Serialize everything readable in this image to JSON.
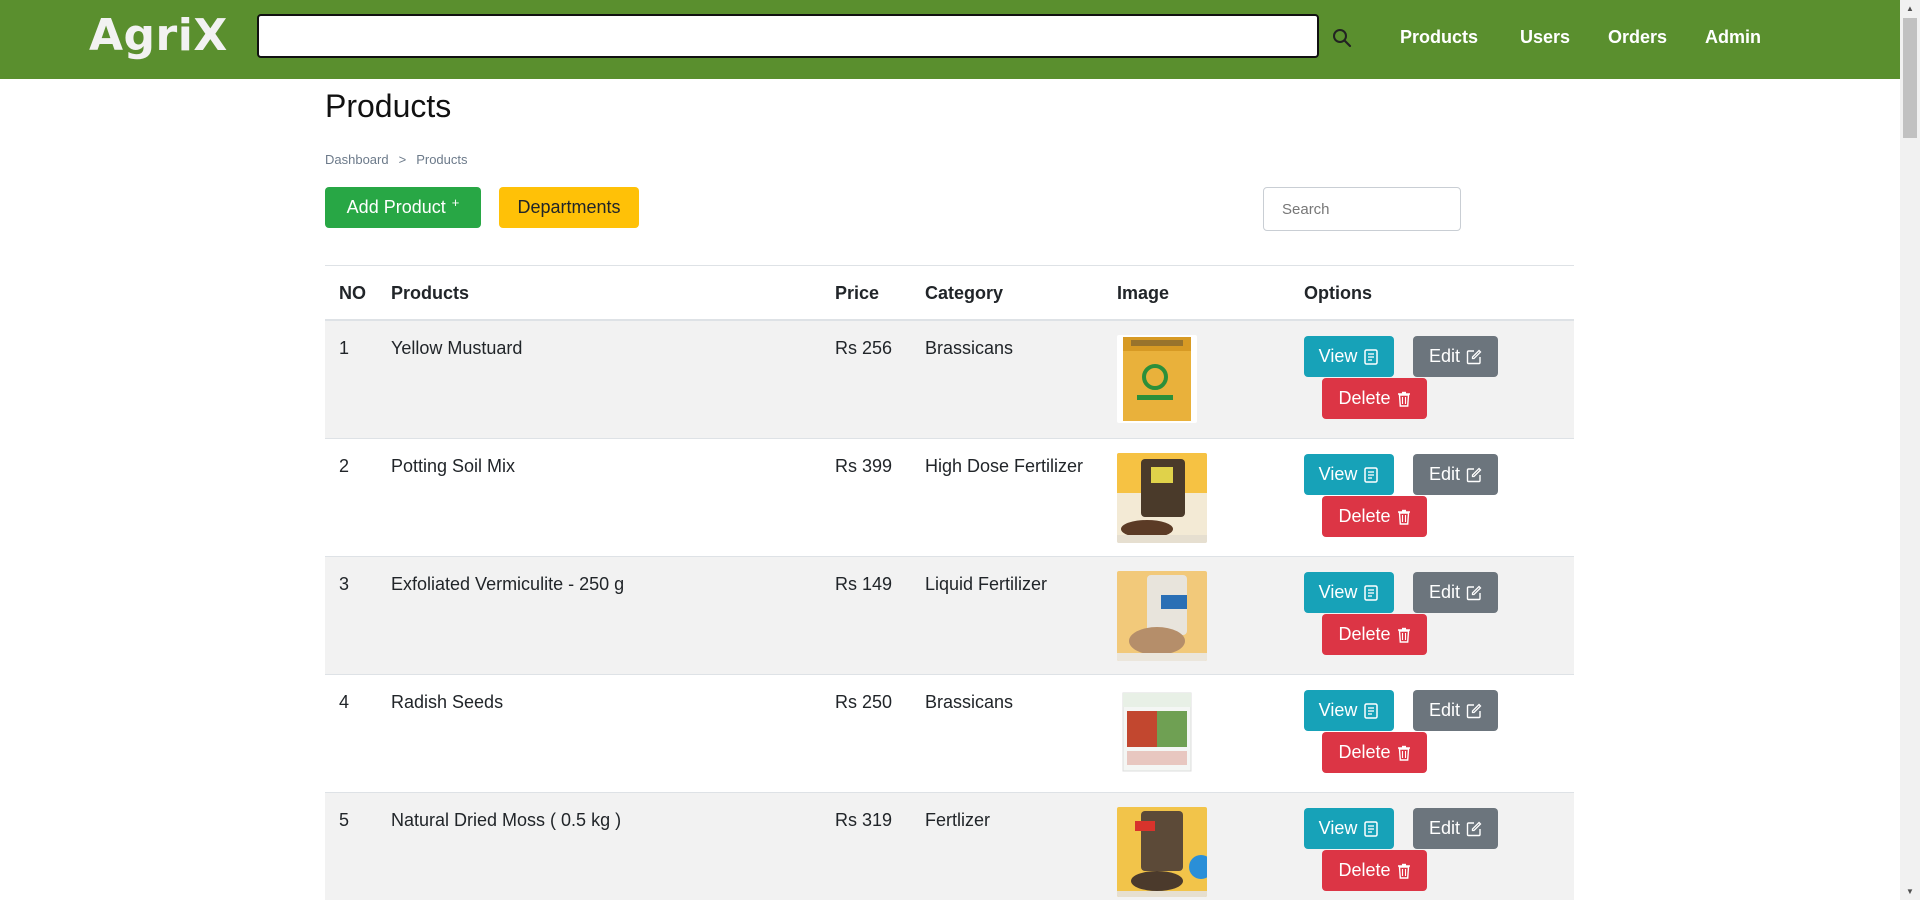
{
  "nav": {
    "brand": "AgriX",
    "search_value": "",
    "links": [
      "Products",
      "Users",
      "Orders",
      "Admin"
    ],
    "color": "#5a8f2e"
  },
  "page": {
    "title": "Products",
    "breadcrumb": [
      "Dashboard",
      ">",
      "Products"
    ],
    "add_button": "Add Product",
    "add_icon": "+",
    "departments_button": "Departments",
    "search_placeholder": "Search"
  },
  "table": {
    "headers": [
      "NO",
      "Products",
      "Price",
      "Category",
      "Image",
      "Options"
    ],
    "actions": {
      "view": "View",
      "edit": "Edit",
      "delete": "Delete"
    },
    "rows": [
      {
        "no": "1",
        "name": "Yellow Mustuard",
        "price": "Rs 256",
        "category": "Brassicans",
        "image": "mustard-packet-image"
      },
      {
        "no": "2",
        "name": "Potting Soil Mix",
        "price": "Rs 399",
        "category": "High Dose Fertilizer",
        "image": "soil-bag-image"
      },
      {
        "no": "3",
        "name": "Exfoliated Vermiculite - 250 g",
        "price": "Rs 149",
        "category": "Liquid Fertilizer",
        "image": "vermiculite-bag-image"
      },
      {
        "no": "4",
        "name": "Radish Seeds",
        "price": "Rs 250",
        "category": "Brassicans",
        "image": "radish-seed-packet-image"
      },
      {
        "no": "5",
        "name": "Natural Dried Moss ( 0.5 kg )",
        "price": "Rs 319",
        "category": "Fertlizer",
        "image": "moss-bag-image"
      }
    ]
  },
  "colors": {
    "success": "#28a745",
    "warning": "#ffc107",
    "info": "#17a2b8",
    "secondary": "#6c757d",
    "danger": "#dc3545"
  }
}
